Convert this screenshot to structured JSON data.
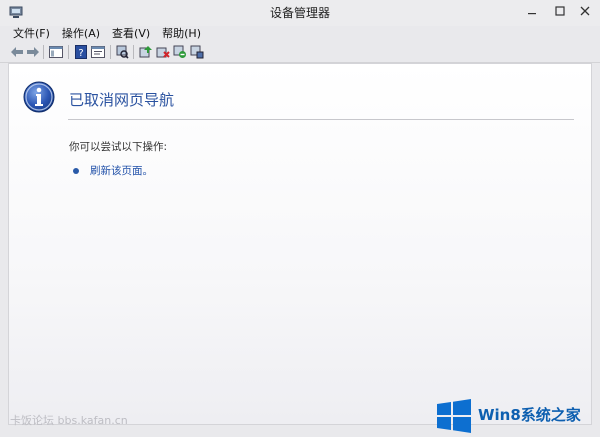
{
  "window": {
    "title": "设备管理器"
  },
  "menu": [
    "文件(F)",
    "操作(A)",
    "查看(V)",
    "帮助(H)"
  ],
  "toolbar": {
    "icons": [
      "back-arrow",
      "forward-arrow",
      "show-hide-tree",
      "help",
      "properties",
      "scan-hardware",
      "update-driver",
      "uninstall-device",
      "disable-device",
      "enable-device"
    ]
  },
  "content": {
    "heading": "已取消网页导航",
    "subtext": "你可以尝试以下操作:",
    "link": "刷新该页面。"
  },
  "watermark": {
    "left": "卡饭论坛 bbs.kafan.cn",
    "brand": "Win8系统之家"
  },
  "colors": {
    "accent": "#2a52a0",
    "link": "#1f4fa8",
    "brand": "#0d5fb0"
  }
}
